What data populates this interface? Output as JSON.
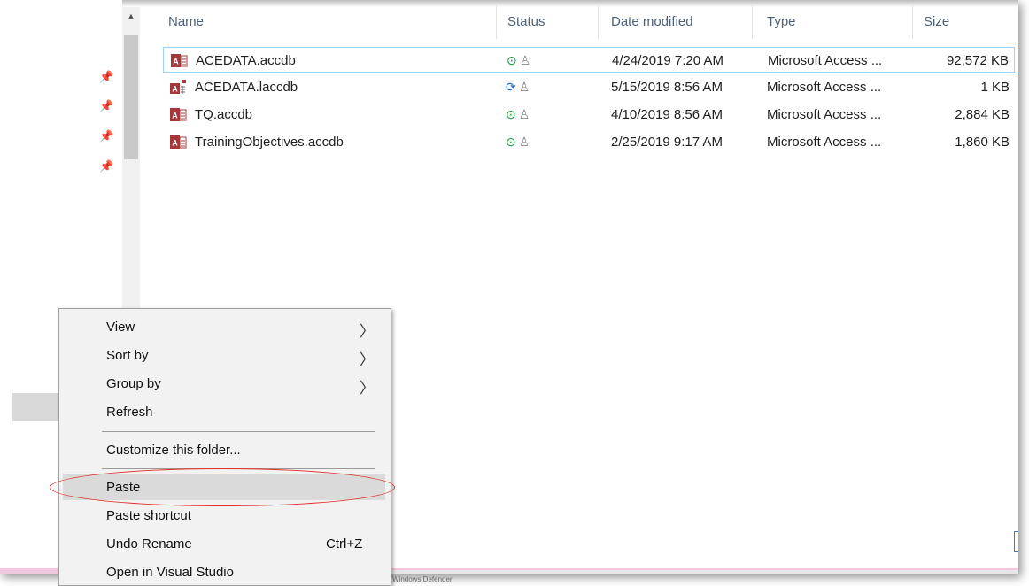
{
  "columns": {
    "name": "Name",
    "status": "Status",
    "date_modified": "Date modified",
    "type": "Type",
    "size": "Size"
  },
  "files": [
    {
      "name": "ACEDATA.accdb",
      "status": "synced",
      "date": "4/24/2019 7:20 AM",
      "type": "Microsoft Access ...",
      "size": "92,572 KB",
      "icon": "access-database-icon"
    },
    {
      "name": "ACEDATA.laccdb",
      "status": "syncing",
      "date": "5/15/2019 8:56 AM",
      "type": "Microsoft Access ...",
      "size": "1 KB",
      "icon": "access-lock-file-icon"
    },
    {
      "name": "TQ.accdb",
      "status": "synced",
      "date": "4/10/2019 8:56 AM",
      "type": "Microsoft Access ...",
      "size": "2,884 KB",
      "icon": "access-database-icon"
    },
    {
      "name": "TrainingObjectives.accdb",
      "status": "synced",
      "date": "2/25/2019 9:17 AM",
      "type": "Microsoft Access ...",
      "size": "1,860 KB",
      "icon": "access-database-icon"
    }
  ],
  "context_menu": {
    "view": "View",
    "sort_by": "Sort by",
    "group_by": "Group by",
    "refresh": "Refresh",
    "customize": "Customize this folder...",
    "paste": "Paste",
    "paste_shortcut": "Paste shortcut",
    "undo_rename": "Undo Rename",
    "undo_shortcut": "Ctrl+Z",
    "open_vs": "Open in Visual Studio"
  },
  "taskbar": {
    "partial_label": "Windows Defender"
  },
  "colors": {
    "access_red": "#a4373a",
    "sync_green": "#1a9e3f",
    "sync_blue": "#1e6fd6",
    "annotation_red": "#e0302a",
    "header_text": "#4c607a"
  }
}
